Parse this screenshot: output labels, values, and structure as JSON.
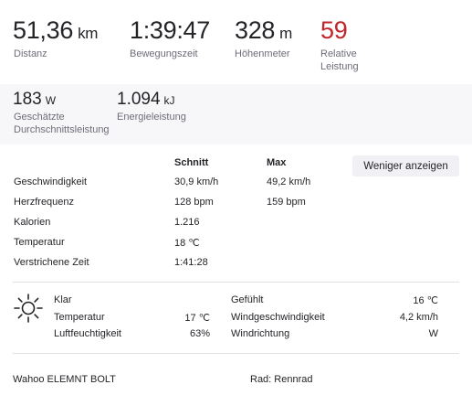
{
  "summary": [
    {
      "value": "51,36",
      "unit": "km",
      "label": "Distanz"
    },
    {
      "value": "1:39:47",
      "unit": "",
      "label": "Bewegungszeit"
    },
    {
      "value": "328",
      "unit": "m",
      "label": "Höhenmeter"
    },
    {
      "value": "59",
      "unit": "",
      "label": "Relative Leistung",
      "color": "#c0252a"
    }
  ],
  "power": {
    "avg_value": "183",
    "avg_unit": "W",
    "avg_label": "Geschätzte Durchschnittsleistung",
    "energy_value": "1.094",
    "energy_unit": "kJ",
    "energy_label": "Energieleistung"
  },
  "stats": {
    "header_avg": "Schnitt",
    "header_max": "Max",
    "toggle_label": "Weniger anzeigen",
    "rows": [
      {
        "label": "Geschwindigkeit",
        "avg": "30,9 km/h",
        "max": "49,2 km/h"
      },
      {
        "label": "Herzfrequenz",
        "avg": "128 bpm",
        "max": "159 bpm"
      },
      {
        "label": "Kalorien",
        "avg": "1.216",
        "max": ""
      },
      {
        "label": "Temperatur",
        "avg": "18 ℃",
        "max": ""
      },
      {
        "label": "Verstrichene Zeit",
        "avg": "1:41:28",
        "max": ""
      }
    ]
  },
  "weather": {
    "icon": "sun-icon",
    "condition": "Klar",
    "left": [
      {
        "label": "Temperatur",
        "value": "17 ℃"
      },
      {
        "label": "Luftfeuchtigkeit",
        "value": "63%"
      }
    ],
    "right": [
      {
        "label": "Gefühlt",
        "value": "16 ℃"
      },
      {
        "label": "Windgeschwindigkeit",
        "value": "4,2 km/h"
      },
      {
        "label": "Windrichtung",
        "value": "W"
      }
    ]
  },
  "gear": {
    "device": "Wahoo ELEMNT BOLT",
    "bike": "Rad: Rennrad"
  }
}
